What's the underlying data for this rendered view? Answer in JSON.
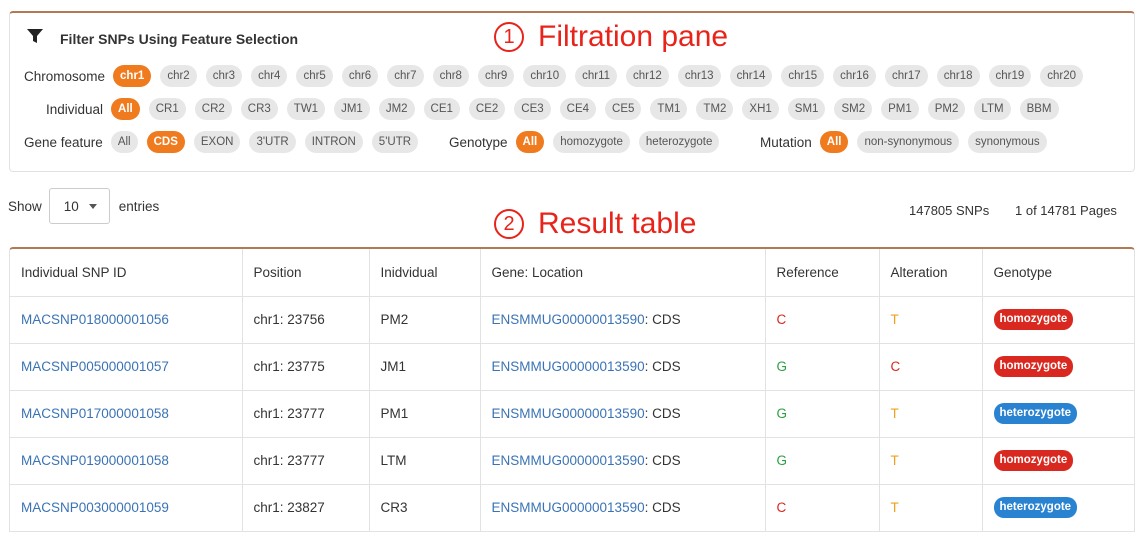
{
  "panel": {
    "title": "Filter SNPs Using Feature Selection",
    "icon": "filter-icon"
  },
  "annotations": {
    "filtration": {
      "num": "1",
      "label": "Filtration pane"
    },
    "result": {
      "num": "2",
      "label": "Result table"
    }
  },
  "filters": {
    "chromosome": {
      "label": "Chromosome",
      "options": [
        "chr1",
        "chr2",
        "chr3",
        "chr4",
        "chr5",
        "chr6",
        "chr7",
        "chr8",
        "chr9",
        "chr10",
        "chr11",
        "chr12",
        "chr13",
        "chr14",
        "chr15",
        "chr16",
        "chr17",
        "chr18",
        "chr19",
        "chr20"
      ],
      "selected": "chr1"
    },
    "individual": {
      "label": "Individual",
      "options": [
        "All",
        "CR1",
        "CR2",
        "CR3",
        "TW1",
        "JM1",
        "JM2",
        "CE1",
        "CE2",
        "CE3",
        "CE4",
        "CE5",
        "TM1",
        "TM2",
        "XH1",
        "SM1",
        "SM2",
        "PM1",
        "PM2",
        "LTM",
        "BBM"
      ],
      "selected": "All"
    },
    "gene_feature": {
      "label": "Gene feature",
      "options": [
        "All",
        "CDS",
        "EXON",
        "3'UTR",
        "INTRON",
        "5'UTR"
      ],
      "selected": "CDS"
    },
    "genotype": {
      "label": "Genotype",
      "options": [
        "All",
        "homozygote",
        "heterozygote"
      ],
      "selected": "All"
    },
    "mutation": {
      "label": "Mutation",
      "options": [
        "All",
        "non-synonymous",
        "synonymous"
      ],
      "selected": "All"
    }
  },
  "entries": {
    "show_label": "Show",
    "value": "10",
    "suffix": "entries"
  },
  "stats": {
    "snp_count": "147805 SNPs",
    "pages": "1 of 14781 Pages"
  },
  "table": {
    "columns": [
      "Individual SNP ID",
      "Position",
      "Inidvidual",
      "Gene: Location",
      "Reference",
      "Alteration",
      "Genotype"
    ],
    "rows": [
      {
        "id": "MACSNP018000001056",
        "position": "chr1: 23756",
        "individual": "PM2",
        "gene": "ENSMMUG00000013590",
        "location": ": CDS",
        "ref": "C",
        "alt": "T",
        "genotype": "homozygote"
      },
      {
        "id": "MACSNP005000001057",
        "position": "chr1: 23775",
        "individual": "JM1",
        "gene": "ENSMMUG00000013590",
        "location": ": CDS",
        "ref": "G",
        "alt": "C",
        "genotype": "homozygote"
      },
      {
        "id": "MACSNP017000001058",
        "position": "chr1: 23777",
        "individual": "PM1",
        "gene": "ENSMMUG00000013590",
        "location": ": CDS",
        "ref": "G",
        "alt": "T",
        "genotype": "heterozygote"
      },
      {
        "id": "MACSNP019000001058",
        "position": "chr1: 23777",
        "individual": "LTM",
        "gene": "ENSMMUG00000013590",
        "location": ": CDS",
        "ref": "G",
        "alt": "T",
        "genotype": "homozygote"
      },
      {
        "id": "MACSNP003000001059",
        "position": "chr1: 23827",
        "individual": "CR3",
        "gene": "ENSMMUG00000013590",
        "location": ": CDS",
        "ref": "C",
        "alt": "T",
        "genotype": "heterozygote"
      }
    ]
  },
  "colors": {
    "accent": "#f07b1f",
    "link": "#3a73b5",
    "base_C": "#d9281f",
    "base_G": "#2ea043",
    "base_T": "#f0a020",
    "homozygote": "#d9281f",
    "heterozygote": "#2a83d1",
    "annotation": "#e8231a"
  }
}
